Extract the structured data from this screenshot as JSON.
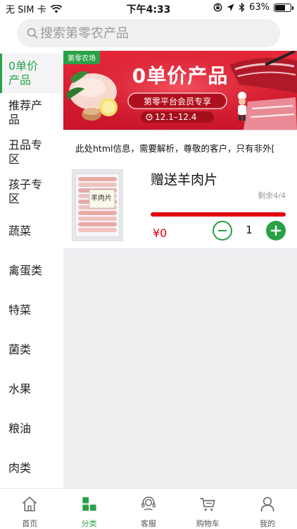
{
  "status_bar": {
    "carrier": "无 SIM 卡",
    "time": "下午4:33",
    "battery_percent": "63%",
    "battery_level": 0.63
  },
  "search": {
    "placeholder": "搜索第零农产品"
  },
  "sidebar": {
    "items": [
      {
        "label": "0单价产品",
        "active": true
      },
      {
        "label": "推荐产品",
        "active": false
      },
      {
        "label": "丑品专区",
        "active": false
      },
      {
        "label": "孩子专区",
        "active": false
      },
      {
        "label": "蔬菜",
        "active": false
      },
      {
        "label": "禽蛋类",
        "active": false
      },
      {
        "label": "特菜",
        "active": false
      },
      {
        "label": "菌类",
        "active": false
      },
      {
        "label": "水果",
        "active": false
      },
      {
        "label": "粮油",
        "active": false
      },
      {
        "label": "肉类",
        "active": false
      }
    ]
  },
  "banner": {
    "tag": "第零农场",
    "title": "0单价产品",
    "subtitle": "第零平台会员专享",
    "date_range": "12.1–12.4"
  },
  "notice": {
    "text": "此处html信息，需要解析，尊敬的客户，只有非外["
  },
  "product": {
    "name": "赠送羊肉片",
    "package_label": "羊肉片",
    "stock": "剩余4/4",
    "progress": 1.0,
    "price": "¥0",
    "quantity": "1"
  },
  "tabbar": {
    "tabs": [
      {
        "label": "首页",
        "icon": "home-icon",
        "active": false
      },
      {
        "label": "分类",
        "icon": "category-icon",
        "active": true
      },
      {
        "label": "客服",
        "icon": "service-icon",
        "active": false
      },
      {
        "label": "购物车",
        "icon": "cart-icon",
        "active": false
      },
      {
        "label": "我的",
        "icon": "profile-icon",
        "active": false
      }
    ]
  },
  "colors": {
    "accent": "#2aa147",
    "price": "#e3000f",
    "banner_red": "#d41c2e"
  }
}
